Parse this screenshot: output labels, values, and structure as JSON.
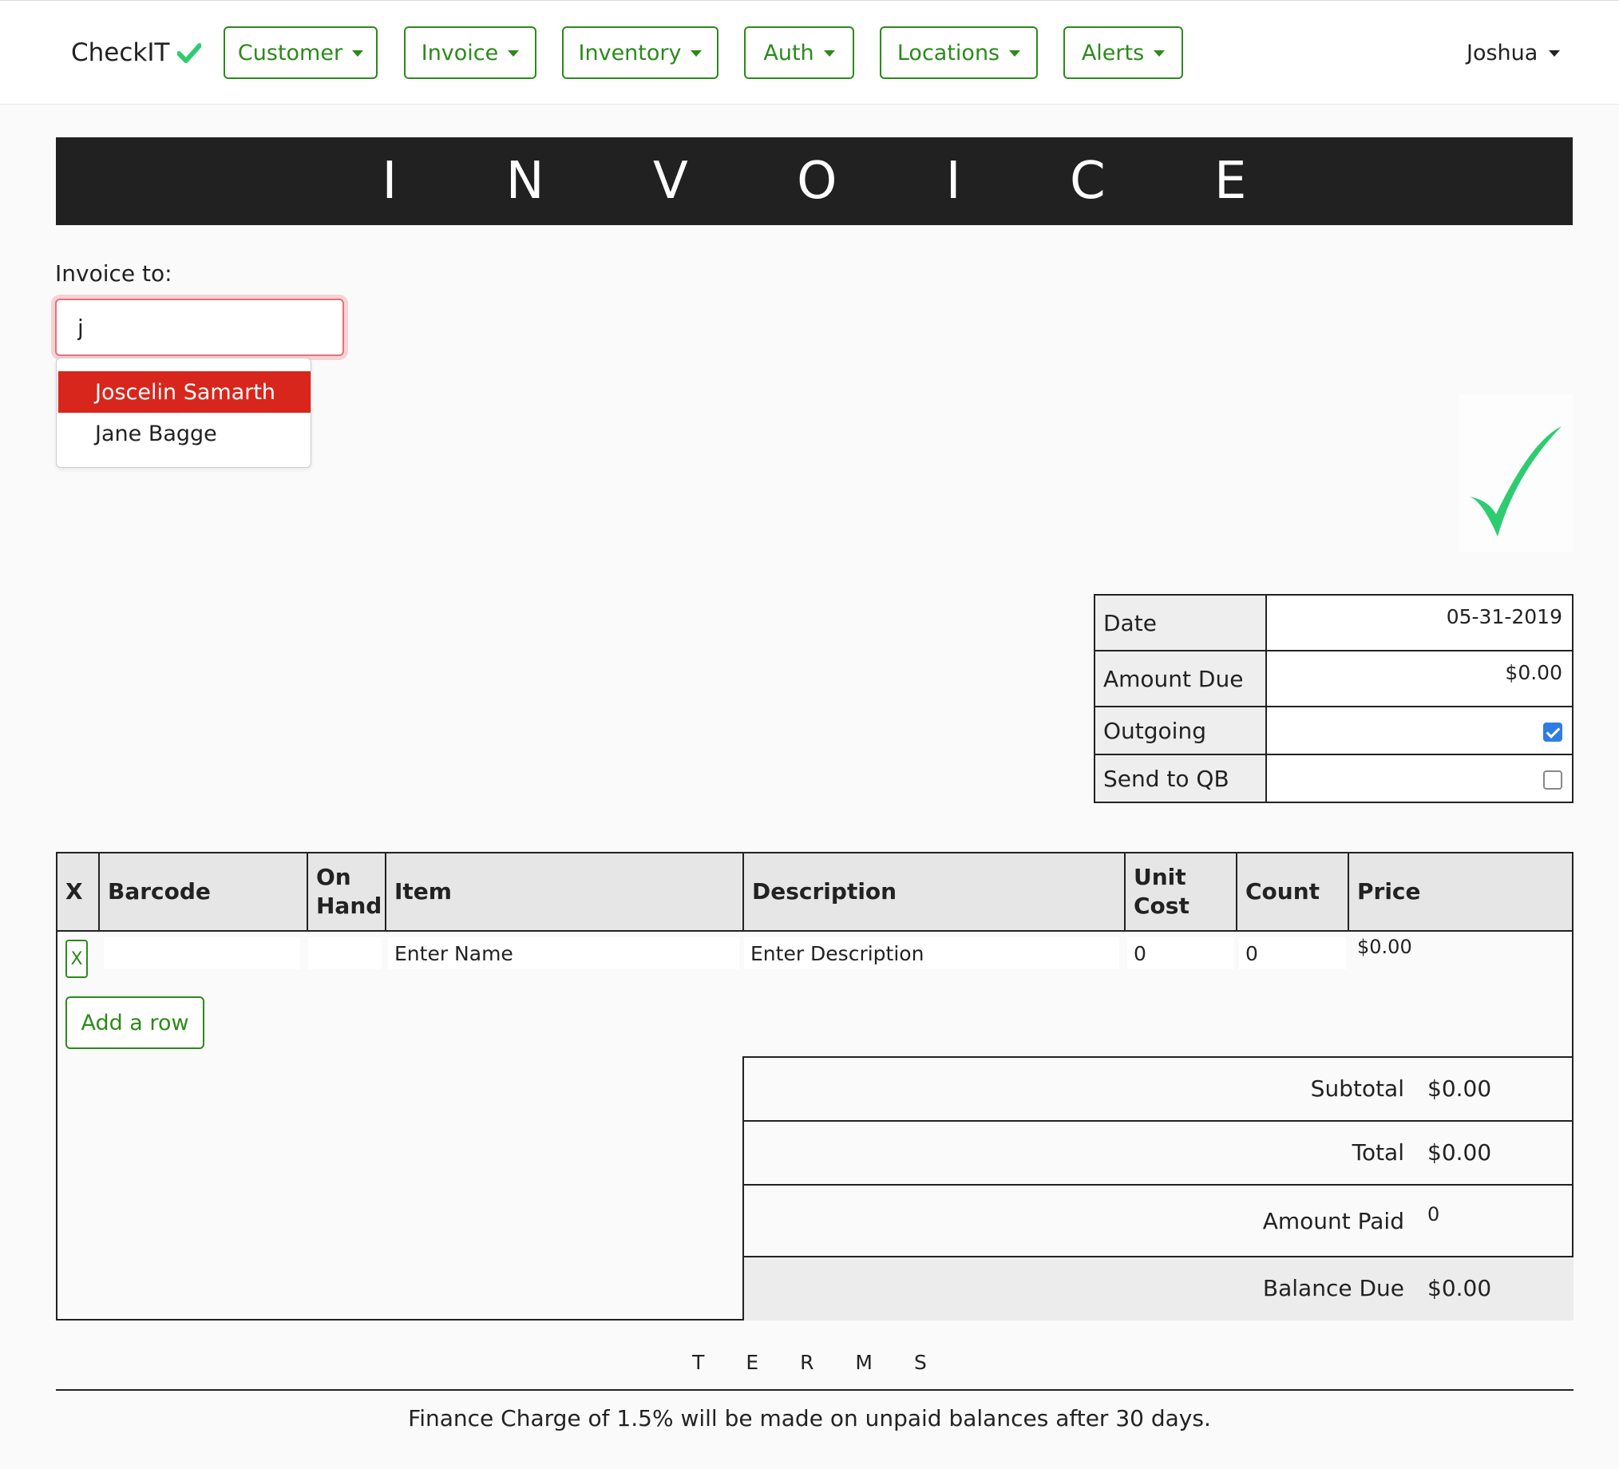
{
  "nav": {
    "brand": "CheckIT",
    "menus": [
      "Customer",
      "Invoice",
      "Inventory",
      "Auth",
      "Locations",
      "Alerts"
    ],
    "user": "Joshua",
    "accent_color": "#2b8a1a",
    "brand_check_color": "#2ecc71"
  },
  "banner": {
    "title": "I N V O I C E"
  },
  "invoice_to": {
    "label": "Invoice to:",
    "value": "j",
    "suggestions": [
      "Joscelin Samarth",
      "Jane Bagge"
    ]
  },
  "info": {
    "date_label": "Date",
    "date_value": "05-31-2019",
    "amount_due_label": "Amount Due",
    "amount_due_value": "$0.00",
    "outgoing_label": "Outgoing",
    "outgoing_checked": true,
    "send_qb_label": "Send to QB",
    "send_qb_checked": false
  },
  "items": {
    "headers": [
      "X",
      "Barcode",
      "On\nHand",
      "Item",
      "Description",
      "Unit\nCost",
      "Count",
      "Price"
    ],
    "rows": [
      {
        "remove": "X",
        "barcode": "",
        "on_hand": "",
        "item": "Enter Name",
        "description": "Enter Description",
        "unit_cost": "0",
        "count": "0",
        "price": "$0.00"
      }
    ],
    "add_row_label": "Add a row"
  },
  "totals": {
    "subtotal_label": "Subtotal",
    "subtotal_value": "$0.00",
    "total_label": "Total",
    "total_value": "$0.00",
    "amount_paid_label": "Amount Paid",
    "amount_paid_value": "0",
    "balance_due_label": "Balance Due",
    "balance_due_value": "$0.00"
  },
  "terms": {
    "title": "T E R M S",
    "text": "Finance Charge of 1.5% will be made on unpaid balances after 30 days."
  }
}
